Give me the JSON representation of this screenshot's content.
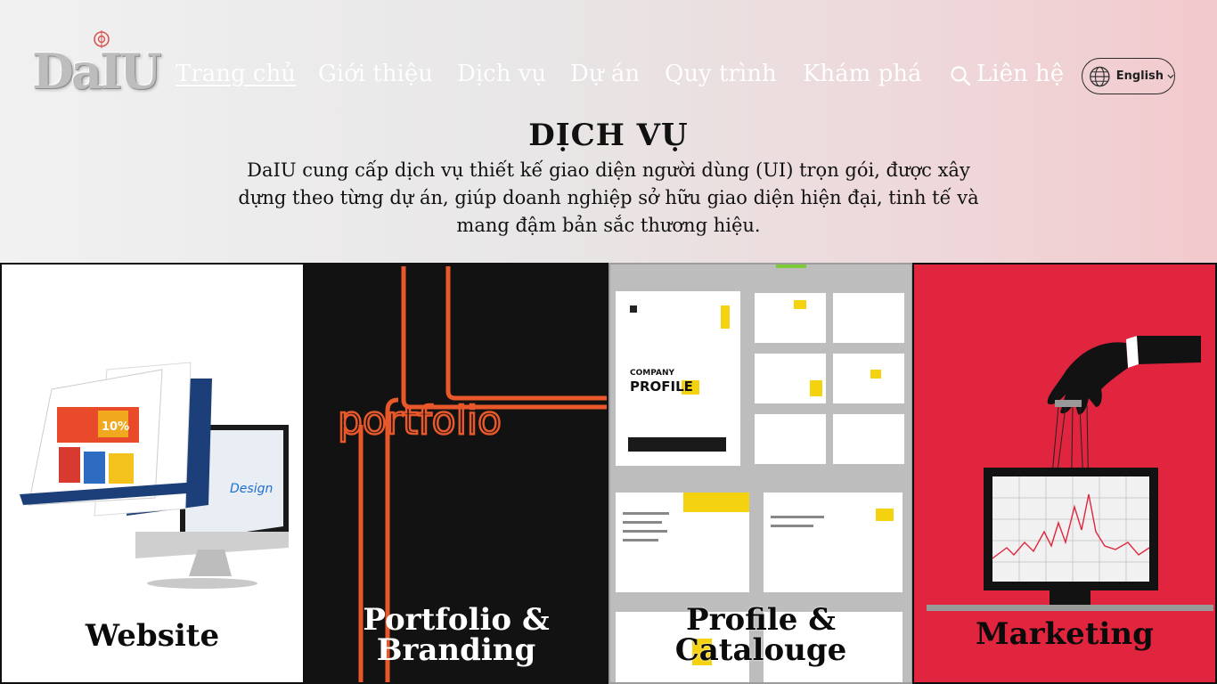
{
  "brand": {
    "logo_text": "DaIU"
  },
  "nav": {
    "items": [
      {
        "label": "Trang chủ",
        "active": true
      },
      {
        "label": "Giới thiệu",
        "active": false
      },
      {
        "label": "Dịch vụ",
        "active": false
      },
      {
        "label": "Dự án",
        "active": false
      },
      {
        "label": "Quy trình",
        "active": false
      },
      {
        "label": "Khám phá",
        "active": false
      },
      {
        "label": "Liên hệ",
        "active": false
      }
    ],
    "search_icon": "search-icon",
    "language": {
      "label": "English",
      "icon": "globe-icon"
    }
  },
  "intro": {
    "title": "DỊCH VỤ",
    "description": "DaIU cung cấp dịch vụ thiết kế giao diện người dùng (UI) trọn gói, được xây dựng theo từng dự án, giúp doanh nghiệp sở hữu giao diện hiện đại, tinh tế và mang đậm bản sắc thương hiệu."
  },
  "services": [
    {
      "title": "Website",
      "image": "website-mockup",
      "background": "#ffffff"
    },
    {
      "title_line1": "Portfolio &",
      "title_line2": "Branding",
      "image": "portfolio-lines",
      "background": "#121212",
      "accent": "#e8582a",
      "image_text": "portfolio"
    },
    {
      "title_line1": "Profile &",
      "title_line2": "Catalouge",
      "image": "company-profile-brochures",
      "background": "#bdbdbd",
      "accent": "#f5d20f",
      "image_text_line1": "COMPANY",
      "image_text_line2": "PROFILE"
    },
    {
      "title": "Marketing",
      "image": "puppet-hand-monitor",
      "background": "#e1253e"
    }
  ],
  "colors": {
    "nav_text": "#ffffff",
    "text": "#111111"
  }
}
